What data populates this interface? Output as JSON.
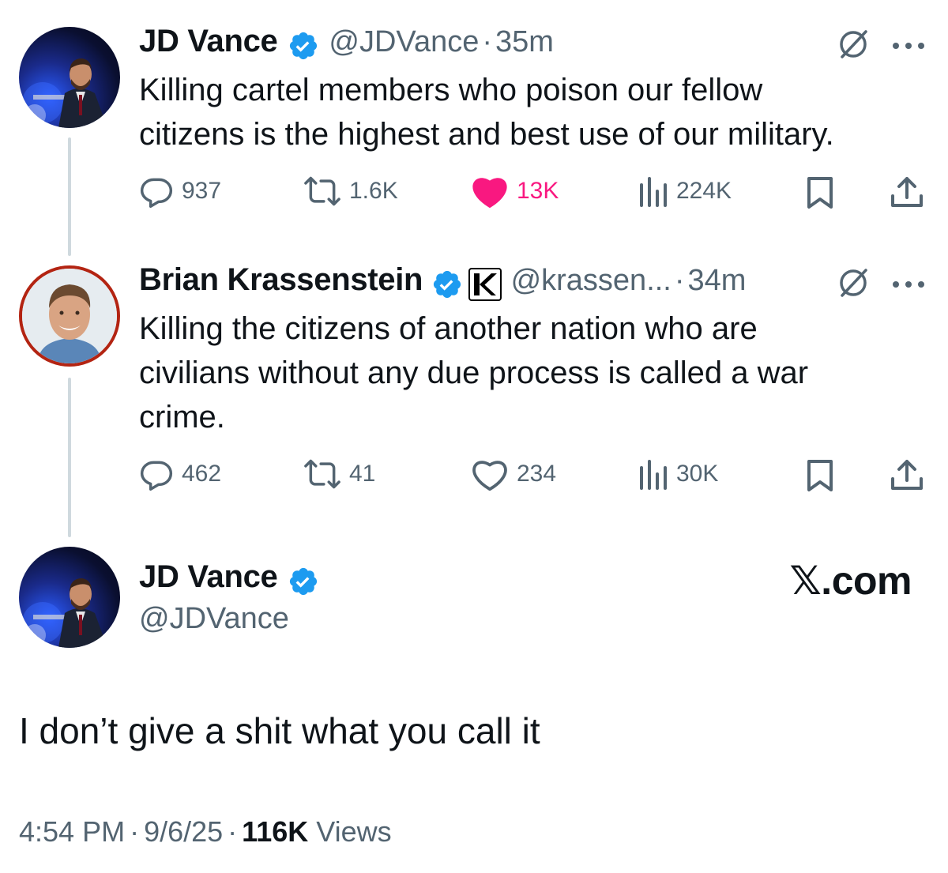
{
  "tweets": [
    {
      "name": "JD Vance",
      "handle": "@JDVance",
      "time": "35m",
      "text_line1": "Killing cartel members who poison our fellow",
      "text_line2": "citizens is the highest and best use of our military.",
      "replies": "937",
      "reposts": "1.6K",
      "likes": "13K",
      "views": "224K",
      "liked": true
    },
    {
      "name": "Brian Krassenstein",
      "handle": "@krassen...",
      "time": "34m",
      "text_line1": "Killing the citizens of another nation who are",
      "text_line2": "civilians without any due process is called a war",
      "text_line3": "crime.",
      "replies": "462",
      "reposts": "41",
      "likes": "234",
      "views": "30K",
      "liked": false
    }
  ],
  "main_tweet": {
    "name": "JD Vance",
    "handle": "@JDVance",
    "text": "I don’t give a shit what you call it",
    "time": "4:54 PM",
    "date": "9/6/25",
    "views_count": "116K",
    "views_label": "Views"
  },
  "brand": "𝕏.com",
  "separator": "·",
  "colors": {
    "verified": "#1d9bf0",
    "like": "#f91880",
    "muted": "#536471",
    "line": "#cfd9de"
  }
}
